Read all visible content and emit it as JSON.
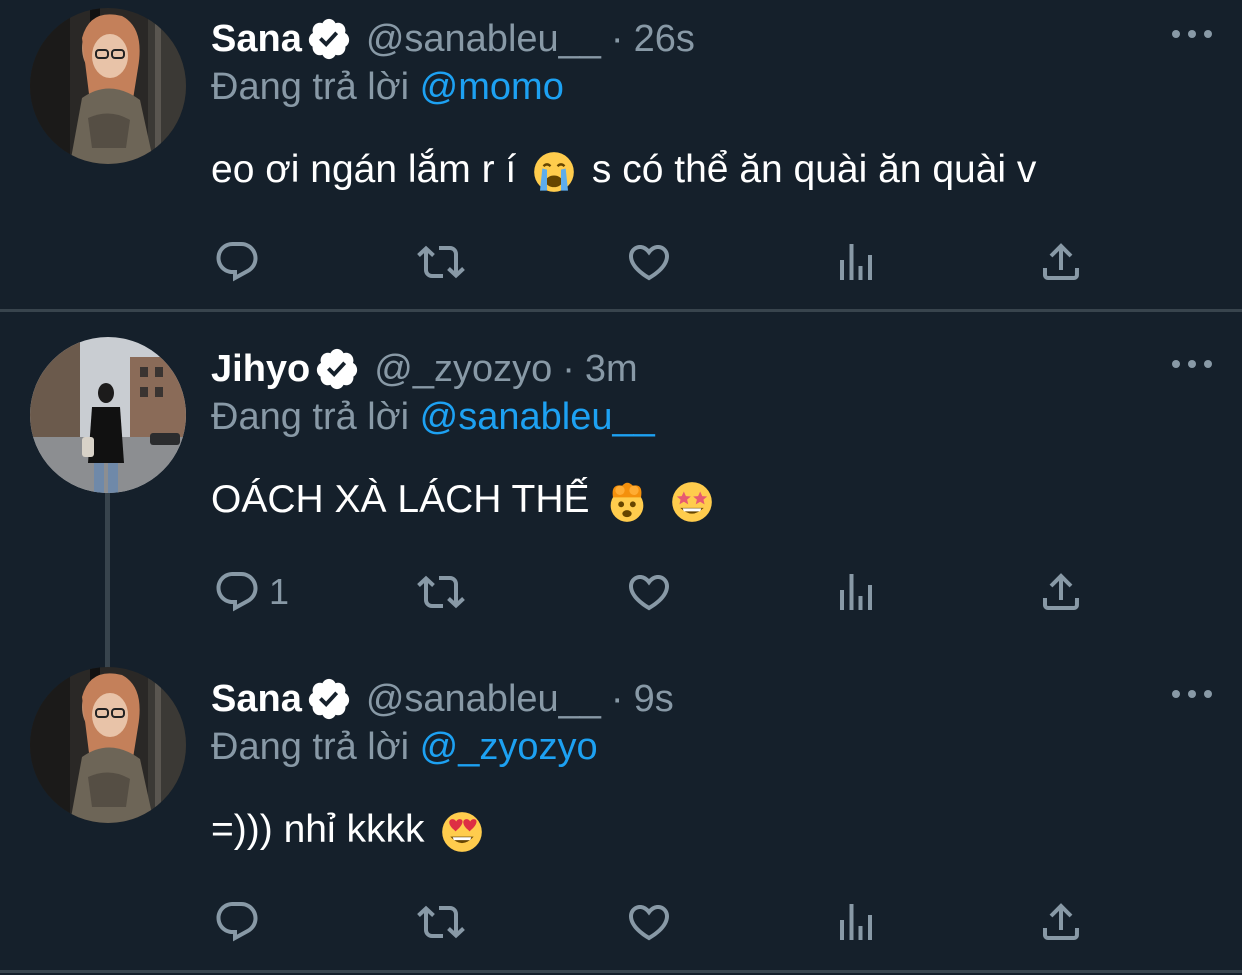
{
  "tweets": [
    {
      "name": "Sana",
      "handle": "@sanableu__",
      "separator": "·",
      "time": "26s",
      "reply_prefix": "Đang trả lời",
      "reply_to": "@momo",
      "text_before_emoji": "eo ơi ngán lắm r í",
      "emoji": "loudly-crying-face",
      "text_after_emoji": "s có thể ăn quài ăn quài v",
      "reply_count": ""
    },
    {
      "name": "Jihyo",
      "handle": "@_zyozyo",
      "separator": "·",
      "time": "3m",
      "reply_prefix": "Đang trả lời",
      "reply_to": "@sanableu__",
      "text": "OÁCH XÀ LÁCH THẾ",
      "emojis": [
        "exploding-head",
        "star-struck"
      ],
      "reply_count": "1"
    },
    {
      "name": "Sana",
      "handle": "@sanableu__",
      "separator": "·",
      "time": "9s",
      "reply_prefix": "Đang trả lời",
      "reply_to": "@_zyozyo",
      "text": "=))) nhỉ kkkk",
      "emoji": "heart-eyes",
      "reply_count": ""
    }
  ],
  "colors": {
    "background": "#15202b",
    "secondary_text": "#8899a6",
    "link": "#1da1f2",
    "verified_badge": "#ffffff",
    "divider": "#38444d"
  }
}
